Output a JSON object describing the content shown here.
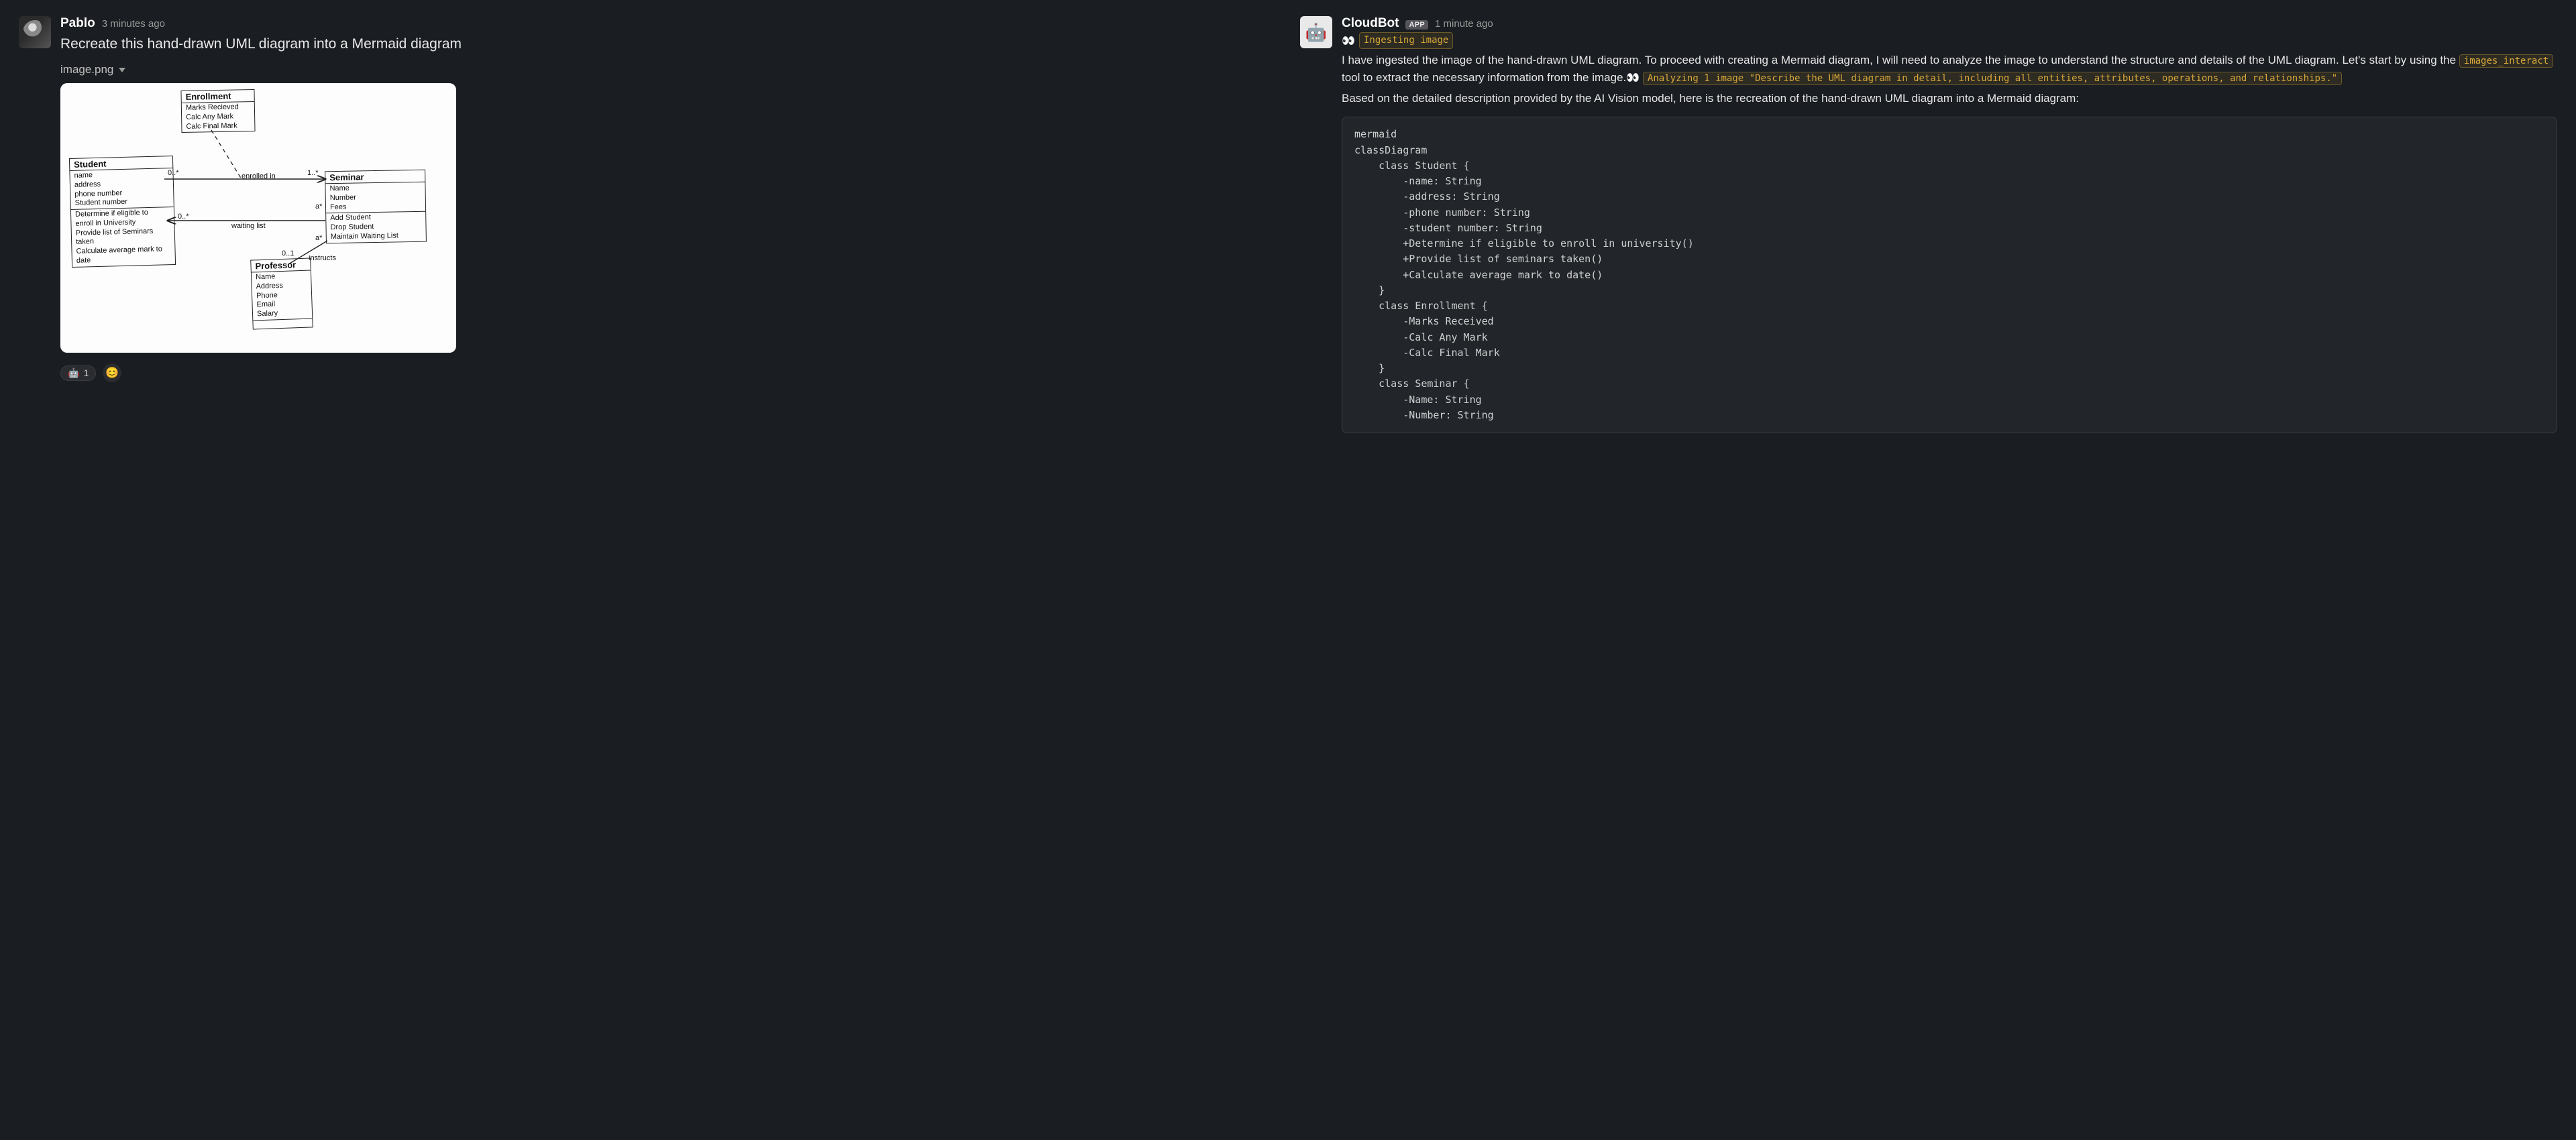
{
  "left": {
    "author": "Pablo",
    "timestamp": "3 minutes ago",
    "message": "Recreate this hand-drawn UML diagram into a Mermaid diagram",
    "attachment_name": "image.png",
    "reaction_emoji": "🤖",
    "reaction_count": "1"
  },
  "uml": {
    "enrollment": {
      "title": "Enrollment",
      "attrs": "Marks Recieved\nCalc Any Mark\nCalc Final Mark"
    },
    "student": {
      "title": "Student",
      "attrs": "name\naddress\nphone number\nStudent number",
      "ops": "Determine if eligible to\n enroll in University\nProvide list of Seminars\n taken\nCalculate average mark to date"
    },
    "seminar": {
      "title": "Seminar",
      "attrs": "Name\nNumber\nFees",
      "ops": "Add Student\nDrop Student\nMaintain Waiting List"
    },
    "professor": {
      "title": "Professor",
      "attrs": "Name\nAddress\nPhone\nEmail\nSalary"
    },
    "labels": {
      "enrolled_in": "enrolled in",
      "zero_star_left": "0..*",
      "one_star": "1..*",
      "waiting_list": "waiting list",
      "zero_star_mid": "0..*",
      "at_left": "a*",
      "at_right": "a*",
      "zero_one": "0..1",
      "instructs": "instructs"
    }
  },
  "right": {
    "author": "CloudBot",
    "app_badge": "APP",
    "timestamp": "1 minute ago",
    "status1": "Ingesting image",
    "para1a": "I have ingested the image of the hand-drawn UML diagram. To proceed with creating a Mermaid diagram, I will need to analyze the image to understand the structure and details of the UML diagram. Let's start by using the ",
    "tool_name": "images_interact",
    "para1b": " tool to extract the necessary information from the image.",
    "status2": "Analyzing 1 image \"Describe the UML diagram in detail, including all entities, attributes, operations, and relationships.\"",
    "para2": "Based on the detailed description provided by the AI Vision model, here is the recreation of the hand-drawn UML diagram into a Mermaid diagram:",
    "code": "mermaid\nclassDiagram\n    class Student {\n        -name: String\n        -address: String\n        -phone number: String\n        -student number: String\n        +Determine if eligible to enroll in university()\n        +Provide list of seminars taken()\n        +Calculate average mark to date()\n    }\n    class Enrollment {\n        -Marks Received\n        -Calc Any Mark\n        -Calc Final Mark\n    }\n    class Seminar {\n        -Name: String\n        -Number: String"
  }
}
